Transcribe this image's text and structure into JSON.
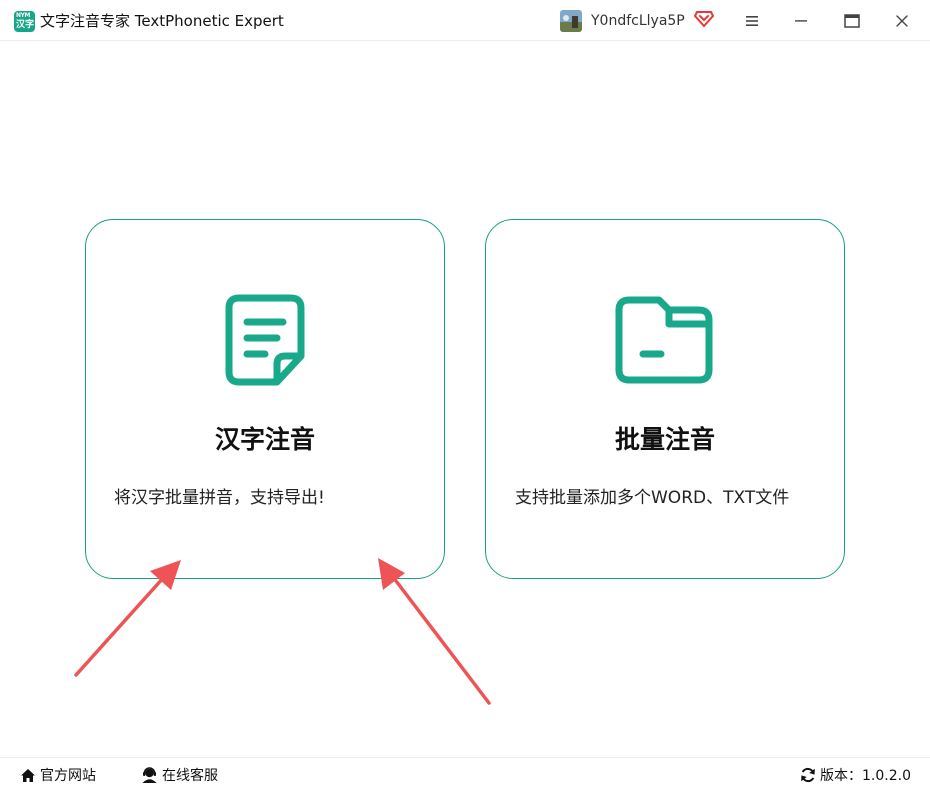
{
  "app": {
    "logo_top": "NYM",
    "logo_bottom": "汉字",
    "title": "文字注音专家 TextPhonetic Expert"
  },
  "user": {
    "name": "Y0ndfcLlya5P"
  },
  "window_controls": {
    "menu_icon": "hamburger-icon",
    "minimize_icon": "minimize-icon",
    "maximize_icon": "maximize-icon",
    "close_icon": "close-icon"
  },
  "cards": [
    {
      "icon": "document-icon",
      "title": "汉字注音",
      "description": "将汉字批量拼音，支持导出!"
    },
    {
      "icon": "folder-icon",
      "title": "批量注音",
      "description": "支持批量添加多个WORD、TXT文件"
    }
  ],
  "footer": {
    "website_label": "官方网站",
    "service_label": "在线客服",
    "version_label": "版本：1.0.2.0"
  },
  "colors": {
    "accent": "#1aa88b",
    "card_border": "#1a9e84",
    "annotation_arrow": "#ee5455",
    "vip_red": "#e53935"
  }
}
